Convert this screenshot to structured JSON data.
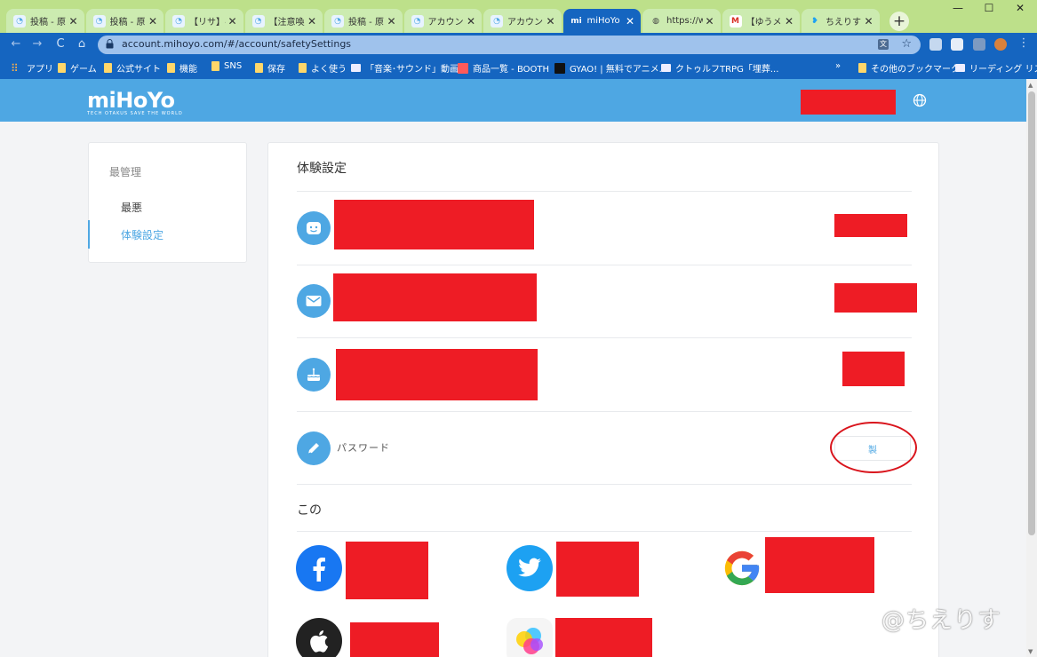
{
  "tabs": [
    {
      "label": "投稿 - 原",
      "fav": "bunny",
      "active": false
    },
    {
      "label": "投稿 - 原",
      "fav": "bunny",
      "active": false
    },
    {
      "label": "【リサ】ベネ",
      "fav": "bunny",
      "active": false
    },
    {
      "label": "【注意喚起",
      "fav": "bunny",
      "active": false
    },
    {
      "label": "投稿 - 原",
      "fav": "bunny",
      "active": false
    },
    {
      "label": "アカウント",
      "fav": "bunny",
      "active": false
    },
    {
      "label": "アカウント",
      "fav": "bunny",
      "active": false
    },
    {
      "label": "miHoYo -",
      "fav": "mihoyo",
      "active": true
    },
    {
      "label": "https://w",
      "fav": "globe",
      "active": false
    },
    {
      "label": "【ゆうメンテ",
      "fav": "gmail",
      "active": false
    },
    {
      "label": "ちえりす",
      "fav": "twitter",
      "active": false
    }
  ],
  "tab_close_glyph": "✕",
  "new_tab_glyph": "+",
  "window_controls": {
    "minimize": "—",
    "maximize": "☐",
    "close": "✕"
  },
  "toolbar": {
    "back": "←",
    "forward": "→",
    "reload": "C",
    "home": "⌂",
    "url": "account.mihoyo.com/#/account/safetySettings",
    "lock": "🔒",
    "star": "☆"
  },
  "bookmarks": [
    {
      "label": "アプリ",
      "icon": "grid"
    },
    {
      "label": "ゲーム",
      "icon": "folder"
    },
    {
      "label": "公式サイト",
      "icon": "folder"
    },
    {
      "label": "機能",
      "icon": "folder"
    },
    {
      "label": "SNS",
      "icon": "folder"
    },
    {
      "label": "保存",
      "icon": "folder"
    },
    {
      "label": "よく使う",
      "icon": "folder"
    },
    {
      "label": "「音楽･サウンド」動画...",
      "icon": "image"
    },
    {
      "label": "商品一覧 - BOOTH",
      "icon": "red"
    },
    {
      "label": "GYAO! | 無料でアニメ...",
      "icon": "dark"
    },
    {
      "label": "クトゥルフTRPG「埋葬...",
      "icon": "image"
    }
  ],
  "bookmarks_more": "»",
  "bookmarks_other": "その他のブックマーク",
  "reading_list": "リーディング リスト",
  "site": {
    "logo": "miHoYo",
    "tagline": "TECH OTAKUS SAVE THE WORLD"
  },
  "sidebar": {
    "section": "最管理",
    "items": [
      "最悪",
      "体験設定"
    ],
    "active_index": 1
  },
  "settings": {
    "title": "体験設定",
    "password_label": "パスワード",
    "edit_button": "製",
    "linked_title": "この"
  },
  "watermark": "@ちえりす",
  "colors": {
    "brand": "#4ea7e3",
    "redaction": "#ee1c25",
    "tab_strip": "#bde08a",
    "toolbar": "#1565c0",
    "annotation": "#d9141c"
  }
}
